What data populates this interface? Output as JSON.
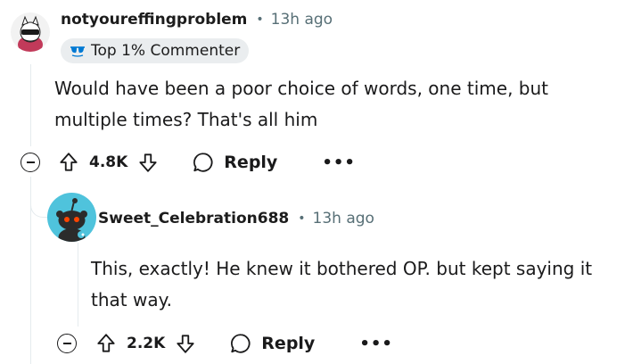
{
  "comments": [
    {
      "username": "notyoureffingproblem",
      "separator": "•",
      "time": "13h ago",
      "flair": "Top 1% Commenter",
      "body_lines": [
        "Would have been a poor choice of words, one time, but",
        "multiple times? That's all him"
      ],
      "vote_count": "4.8K",
      "reply_label": "Reply",
      "more_label": "•••"
    },
    {
      "username": "Sweet_Celebration688",
      "separator": "•",
      "time": "13h ago",
      "body_lines": [
        "This, exactly! He knew it bothered OP. but kept saying it",
        "that way."
      ],
      "vote_count": "2.2K",
      "reply_label": "Reply",
      "more_label": "•••",
      "avatar_color": "#4fc3dc"
    }
  ]
}
